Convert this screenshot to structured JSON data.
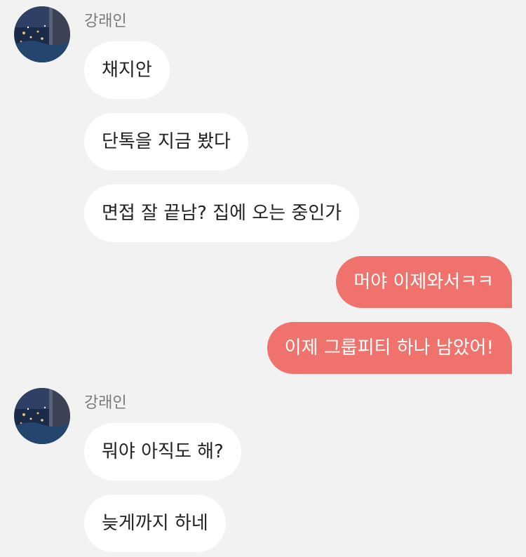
{
  "sender_name": "강래인",
  "colors": {
    "background": "#f2f2f2",
    "received_bubble": "#ffffff",
    "sent_bubble": "#ef736c",
    "sender_name": "#7a7a7a"
  },
  "avatar_icon": "profile-photo-night-sea",
  "messages": [
    {
      "from": "강래인",
      "text": "채지안"
    },
    {
      "from": "강래인",
      "text": "단톡을 지금 봤다"
    },
    {
      "from": "강래인",
      "text": "면접 잘 끝남? 집에 오는 중인가"
    },
    {
      "from": "me",
      "text": "머야 이제와서ㅋㅋ"
    },
    {
      "from": "me",
      "text": "이제 그룹피티 하나 남았어!"
    },
    {
      "from": "강래인",
      "text": "뭐야 아직도 해?"
    },
    {
      "from": "강래인",
      "text": "늦게까지 하네"
    }
  ]
}
